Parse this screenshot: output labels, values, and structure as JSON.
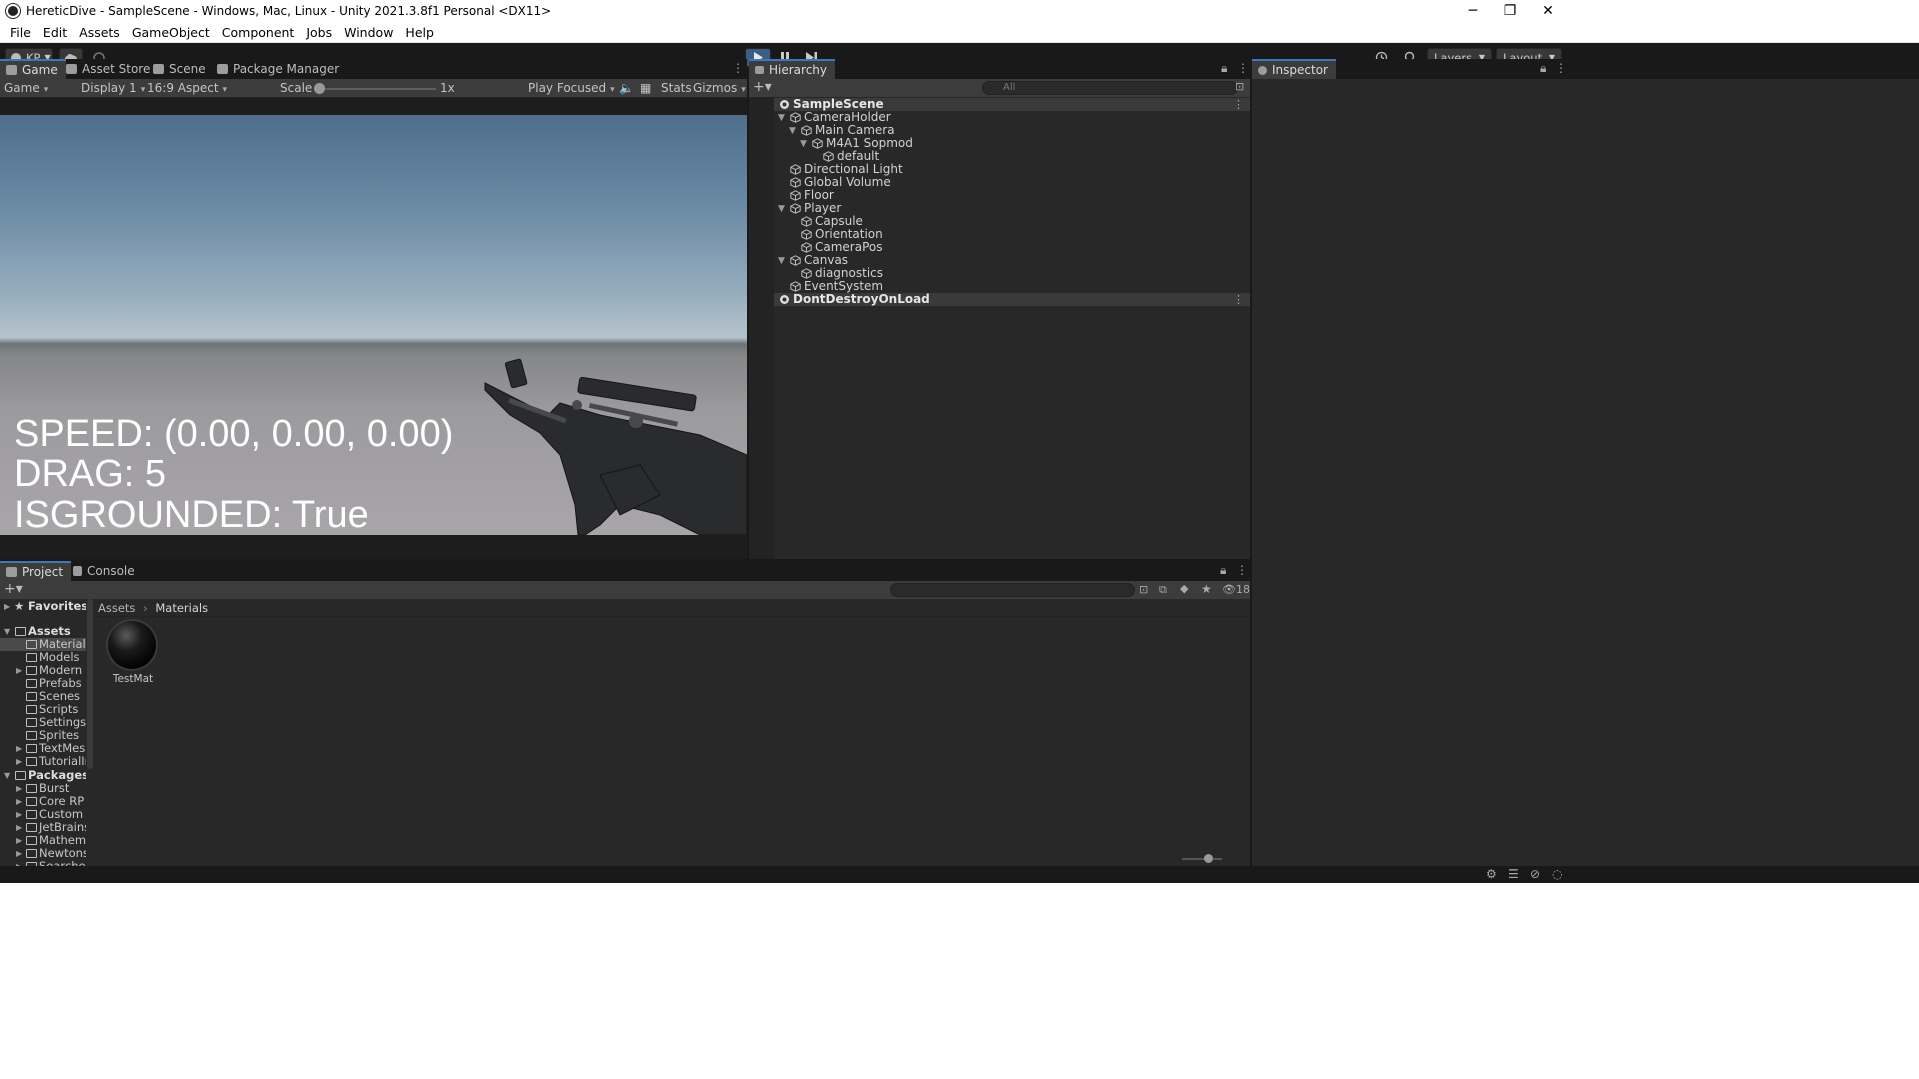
{
  "window": {
    "title": "HereticDive - SampleScene - Windows, Mac, Linux - Unity 2021.3.8f1 Personal <DX11>",
    "controls": [
      "─",
      "❐",
      "✕"
    ]
  },
  "menu": [
    "File",
    "Edit",
    "Assets",
    "GameObject",
    "Component",
    "Jobs",
    "Window",
    "Help"
  ],
  "toolbar": {
    "account": "KP",
    "layers_label": "Layers",
    "layout_label": "Layout",
    "play_active": true
  },
  "game_panel": {
    "tabs": [
      "Game",
      "Asset Store",
      "Scene",
      "Package Manager"
    ],
    "active_tab": "Game",
    "view_mode": "Game",
    "display": "Display 1",
    "aspect": "16:9 Aspect",
    "scale_label": "Scale",
    "scale_value": "1x",
    "play_mode": "Play Focused",
    "stats_label": "Stats",
    "gizmos_label": "Gizmos",
    "hud": {
      "speed": "SPEED: (0.00, 0.00, 0.00)",
      "drag": "DRAG: 5",
      "grounded": "ISGROUNDED: True"
    }
  },
  "hierarchy": {
    "title": "Hierarchy",
    "search_placeholder": "All",
    "items": [
      {
        "label": "SampleScene",
        "depth": 0,
        "expanded": true,
        "scene": true
      },
      {
        "label": "CameraHolder",
        "depth": 1,
        "expanded": true
      },
      {
        "label": "Main Camera",
        "depth": 2,
        "expanded": true
      },
      {
        "label": "M4A1 Sopmod",
        "depth": 3,
        "expanded": true
      },
      {
        "label": "default",
        "depth": 4
      },
      {
        "label": "Directional Light",
        "depth": 1
      },
      {
        "label": "Global Volume",
        "depth": 1
      },
      {
        "label": "Floor",
        "depth": 1
      },
      {
        "label": "Player",
        "depth": 1,
        "expanded": true
      },
      {
        "label": "Capsule",
        "depth": 2
      },
      {
        "label": "Orientation",
        "depth": 2
      },
      {
        "label": "CameraPos",
        "depth": 2
      },
      {
        "label": "Canvas",
        "depth": 1,
        "expanded": true
      },
      {
        "label": "diagnostics",
        "depth": 2
      },
      {
        "label": "EventSystem",
        "depth": 1
      },
      {
        "label": "DontDestroyOnLoad",
        "depth": 0,
        "expanded": false,
        "scene": true
      }
    ]
  },
  "inspector": {
    "title": "Inspector"
  },
  "project": {
    "tabs": [
      "Project",
      "Console"
    ],
    "hidden_count": "18",
    "breadcrumb": [
      "Assets",
      "Materials"
    ],
    "favorites_label": "Favorites",
    "assets_label": "Assets",
    "asset_folders": [
      {
        "label": "Materials",
        "selected": true,
        "has_children": false
      },
      {
        "label": "Models",
        "has_children": false
      },
      {
        "label": "Modern W",
        "has_children": true
      },
      {
        "label": "Prefabs",
        "has_children": false
      },
      {
        "label": "Scenes",
        "has_children": false
      },
      {
        "label": "Scripts",
        "has_children": false
      },
      {
        "label": "Settings",
        "has_children": false
      },
      {
        "label": "Sprites",
        "has_children": false
      },
      {
        "label": "TextMesh",
        "has_children": true
      },
      {
        "label": "TutorialIn",
        "has_children": true
      }
    ],
    "packages_label": "Packages",
    "package_folders": [
      "Burst",
      "Core RP L",
      "Custom N",
      "JetBrains",
      "Mathema",
      "Newtons",
      "Searcher"
    ],
    "files": [
      {
        "name": "TestMat",
        "type": "material"
      }
    ]
  },
  "colors": {
    "accent": "#3a79bb",
    "panel": "#282828",
    "tabbar": "#191919",
    "toolbar": "#3c3c3c"
  }
}
